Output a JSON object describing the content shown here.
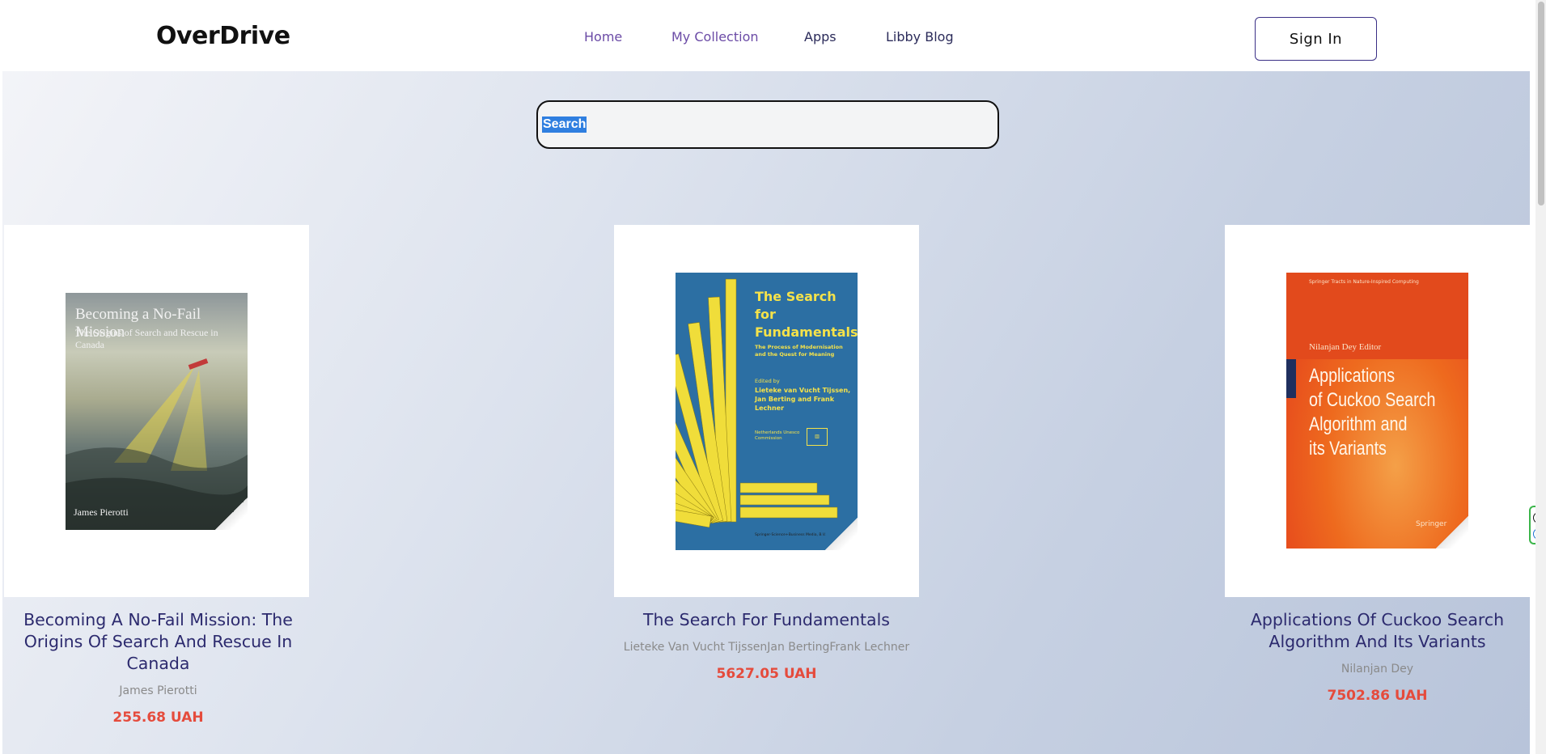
{
  "header": {
    "logo": "OverDrive",
    "nav": [
      "Home",
      "My Collection",
      "Apps",
      "Libby Blog"
    ],
    "sign_in": "Sign In"
  },
  "search": {
    "placeholder": "Search"
  },
  "books": [
    {
      "title": "Becoming A No-Fail Mission: The Origins Of Search And Rescue In Canada",
      "author": "James Pierotti",
      "price": "255.68 UAH",
      "cover": {
        "title": "Becoming a No-Fail Mission",
        "subtitle": "The Origins of Search and Rescue in Canada",
        "author": "James Pierotti"
      }
    },
    {
      "title": "The Search For Fundamentals",
      "author": "Lieteke Van Vucht TijssenJan BertingFrank Lechner",
      "price": "5627.05 UAH",
      "cover": {
        "title_line1": "The Search",
        "title_line2": "for",
        "title_line3": "Fundamentals",
        "subtitle": "The Process of Modernisation and the Quest for Meaning",
        "edited_by": "Edited by",
        "editors": "Lieteke van Vucht Tijssen, Jan Berting and Frank Lechner",
        "commission": "Netherlands Unesco Commission",
        "publisher": "Springer-Science+Business Media, B.V."
      }
    },
    {
      "title": "Applications Of Cuckoo Search Algorithm And Its Variants",
      "author": "Nilanjan Dey",
      "price": "7502.86 UAH",
      "cover": {
        "series": "Springer Tracts in Nature-Inspired Computing",
        "editor": "Nilanjan Dey  Editor",
        "title_line1": "Applications",
        "title_line2": "of Cuckoo Search",
        "title_line3": "Algorithm and",
        "title_line4": "its Variants",
        "publisher": "Springer"
      }
    }
  ],
  "colors": {
    "nav_link": "#6b4ba6",
    "title": "#2c2a6e",
    "price": "#e54b3c",
    "author": "#8a8a8a"
  }
}
